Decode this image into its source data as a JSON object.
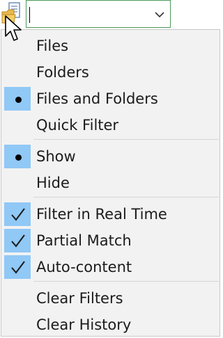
{
  "filter_bar": {
    "input_value": "",
    "icon": "file-folder-icon",
    "dropdown_icon": "chevron-down-icon",
    "border_color": "#4a9a59"
  },
  "menu": {
    "selected_color": "#90c8f6",
    "groups": [
      {
        "items": [
          {
            "label": "Files",
            "mark": "none"
          },
          {
            "label": "Folders",
            "mark": "none"
          },
          {
            "label": "Files and Folders",
            "mark": "radio"
          },
          {
            "label": "Quick Filter",
            "mark": "none"
          }
        ]
      },
      {
        "items": [
          {
            "label": "Show",
            "mark": "radio"
          },
          {
            "label": "Hide",
            "mark": "none"
          }
        ]
      },
      {
        "items": [
          {
            "label": "Filter in Real Time",
            "mark": "check"
          },
          {
            "label": "Partial Match",
            "mark": "check"
          },
          {
            "label": "Auto-content",
            "mark": "check"
          }
        ]
      },
      {
        "items": [
          {
            "label": "Clear Filters",
            "mark": "none"
          },
          {
            "label": "Clear History",
            "mark": "none"
          }
        ]
      }
    ]
  }
}
